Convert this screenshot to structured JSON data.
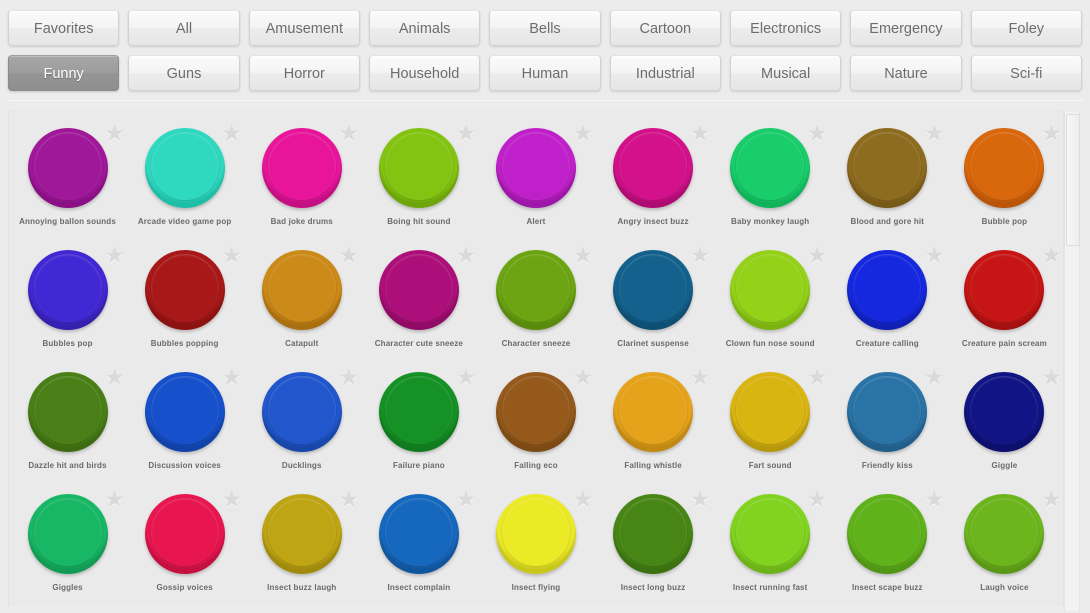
{
  "tabs": {
    "row1": [
      {
        "label": "Favorites",
        "active": false
      },
      {
        "label": "All",
        "active": false
      },
      {
        "label": "Amusement",
        "active": false
      },
      {
        "label": "Animals",
        "active": false
      },
      {
        "label": "Bells",
        "active": false
      },
      {
        "label": "Cartoon",
        "active": false
      },
      {
        "label": "Electronics",
        "active": false
      },
      {
        "label": "Emergency",
        "active": false
      },
      {
        "label": "Foley",
        "active": false
      }
    ],
    "row2": [
      {
        "label": "Funny",
        "active": true
      },
      {
        "label": "Guns",
        "active": false
      },
      {
        "label": "Horror",
        "active": false
      },
      {
        "label": "Household",
        "active": false
      },
      {
        "label": "Human",
        "active": false
      },
      {
        "label": "Industrial",
        "active": false
      },
      {
        "label": "Musical",
        "active": false
      },
      {
        "label": "Nature",
        "active": false
      },
      {
        "label": "Sci-fi",
        "active": false
      }
    ]
  },
  "star_glyph": "★",
  "star_color": "#dadada",
  "sounds": [
    {
      "label": "Annoying ballon sounds",
      "color": "#a0189a",
      "ring": "#8a0f85",
      "favorite": false
    },
    {
      "label": "Arcade video game pop",
      "color": "#2fd9c0",
      "ring": "#1fbfa7",
      "favorite": false
    },
    {
      "label": "Bad joke drums",
      "color": "#e8159a",
      "ring": "#c40f83",
      "favorite": false
    },
    {
      "label": "Boing hit sound",
      "color": "#83c412",
      "ring": "#6ea50c",
      "favorite": false
    },
    {
      "label": "Alert",
      "color": "#c020c9",
      "ring": "#9d17a8",
      "favorite": false
    },
    {
      "label": "Angry insect buzz",
      "color": "#d2118a",
      "ring": "#ae0c73",
      "favorite": false
    },
    {
      "label": "Baby monkey laugh",
      "color": "#18cd6a",
      "ring": "#11b35a",
      "favorite": false
    },
    {
      "label": "Blood and gore hit",
      "color": "#8d6b1f",
      "ring": "#785a18",
      "favorite": false
    },
    {
      "label": "Bubble pop",
      "color": "#d9670c",
      "ring": "#b95509",
      "favorite": false
    },
    {
      "label": "Bubbles pop",
      "color": "#4228d4",
      "ring": "#3520ae",
      "favorite": false
    },
    {
      "label": "Bubbles popping",
      "color": "#a81818",
      "ring": "#8c1111",
      "favorite": false
    },
    {
      "label": "Catapult",
      "color": "#cc8a18",
      "ring": "#a96f10",
      "favorite": false
    },
    {
      "label": "Character cute sneeze",
      "color": "#ad0f7a",
      "ring": "#8f0b65",
      "favorite": false
    },
    {
      "label": "Character sneeze",
      "color": "#6ca412",
      "ring": "#5a8a0d",
      "favorite": false
    },
    {
      "label": "Clarinet suspense",
      "color": "#13618c",
      "ring": "#0e4f73",
      "favorite": false
    },
    {
      "label": "Clown fun nose sound",
      "color": "#94d219",
      "ring": "#7cb313",
      "favorite": false
    },
    {
      "label": "Creature calling",
      "color": "#1528df",
      "ring": "#1020b5",
      "favorite": false
    },
    {
      "label": "Creature pain scream",
      "color": "#c71515",
      "ring": "#a41010",
      "favorite": false
    },
    {
      "label": "Dazzle hit and birds",
      "color": "#497f16",
      "ring": "#3d6b11",
      "favorite": false
    },
    {
      "label": "Discussion voices",
      "color": "#1650cb",
      "ring": "#1142a8",
      "favorite": false
    },
    {
      "label": "Ducklings",
      "color": "#2156cc",
      "ring": "#1947a9",
      "favorite": false
    },
    {
      "label": "Failure piano",
      "color": "#159125",
      "ring": "#0f7a1e",
      "favorite": false
    },
    {
      "label": "Falling eco",
      "color": "#94591b",
      "ring": "#7b4a15",
      "favorite": false
    },
    {
      "label": "Falling whistle",
      "color": "#e5a31b",
      "ring": "#c28814",
      "favorite": false
    },
    {
      "label": "Fart sound",
      "color": "#d9b512",
      "ring": "#b7980d",
      "favorite": false
    },
    {
      "label": "Friendly kiss",
      "color": "#2a73a6",
      "ring": "#215e8a",
      "favorite": false
    },
    {
      "label": "Giggle",
      "color": "#111484",
      "ring": "#0c0f6c",
      "favorite": false
    },
    {
      "label": "Giggles",
      "color": "#18b765",
      "ring": "#129b55",
      "favorite": false
    },
    {
      "label": "Gossip voices",
      "color": "#e8164f",
      "ring": "#c31041",
      "favorite": false
    },
    {
      "label": "Insect buzz laugh",
      "color": "#bfa513",
      "ring": "#a08a0e",
      "favorite": false
    },
    {
      "label": "Insect complain",
      "color": "#1668be",
      "ring": "#11559d",
      "favorite": false
    },
    {
      "label": "Insect flying",
      "color": "#ecea25",
      "ring": "#c9c71c",
      "favorite": false
    },
    {
      "label": "Insect long buzz",
      "color": "#478615",
      "ring": "#3b7110",
      "favorite": false
    },
    {
      "label": "Insect running fast",
      "color": "#81d320",
      "ring": "#6cb319",
      "favorite": false
    },
    {
      "label": "Insect scape buzz",
      "color": "#60b21b",
      "ring": "#509715",
      "favorite": false
    },
    {
      "label": "Laugh voice",
      "color": "#6cb51d",
      "ring": "#5a9917",
      "favorite": false
    }
  ]
}
